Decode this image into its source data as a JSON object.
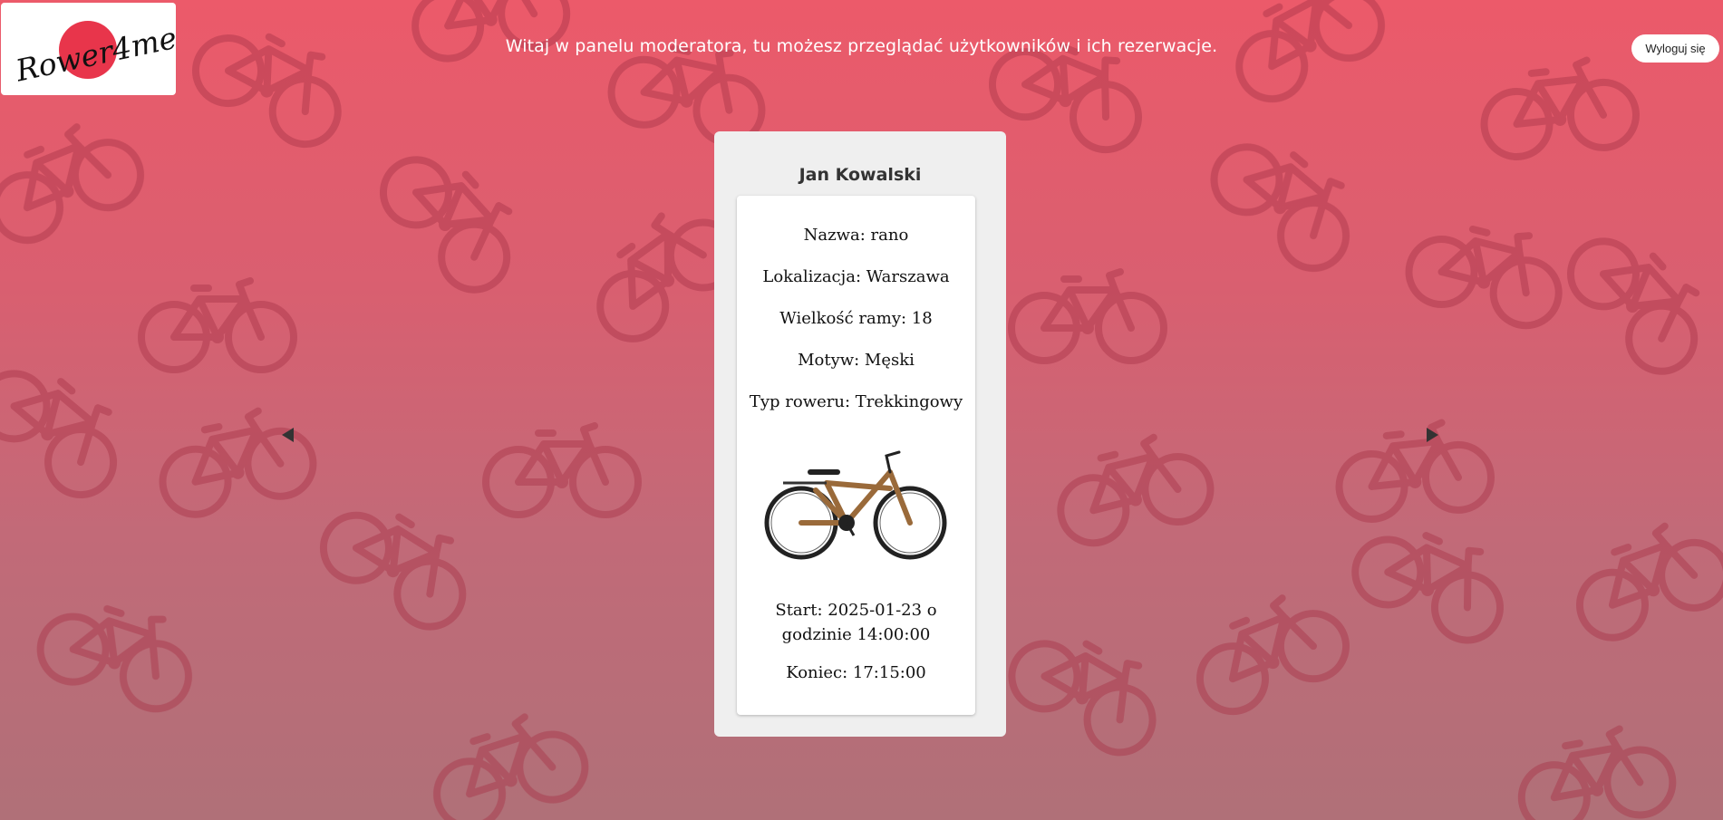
{
  "header": {
    "logo_text": "Rower4me",
    "welcome": "Witaj w panelu moderatora, tu możesz przeglądać użytkowników i ich rezerwacje.",
    "logout_label": "Wyloguj się"
  },
  "reservation": {
    "user_name": "Jan Kowalski",
    "name_field": "Nazwa: rano",
    "location_field": "Lokalizacja: Warszawa",
    "frame_field": "Wielkość ramy: 18",
    "motif_field": "Motyw: Męski",
    "type_field": "Typ roweru: Trekkingowy",
    "start_field": "Start: 2025-01-23 o godzinie 14:00:00",
    "end_field": "Koniec: 17:15:00"
  },
  "icons": {
    "prev": "triangle-left-icon",
    "next": "triangle-right-icon"
  },
  "colors": {
    "accent": "#e8354b",
    "background_top": "#ec5a6a",
    "background_bottom": "#b07078",
    "pattern": "#a83548"
  }
}
